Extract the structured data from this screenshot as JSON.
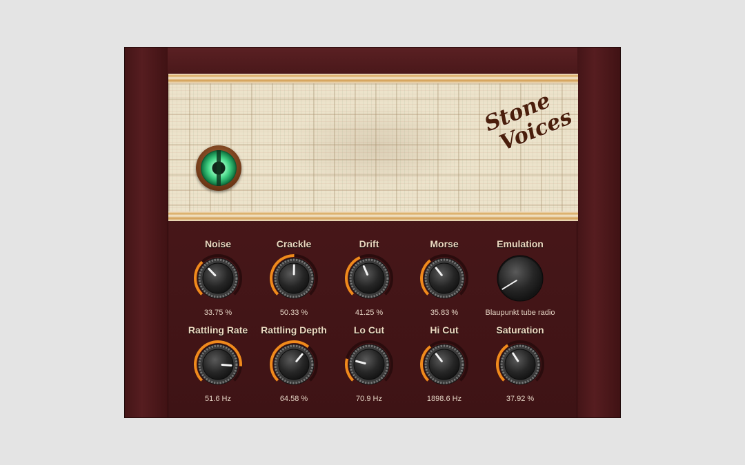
{
  "logo": {
    "line1": "Stone",
    "line2": "Voices"
  },
  "accent_color": "#f08a1c",
  "power_button": {
    "icon": "power-lamp-icon"
  },
  "knobs": [
    {
      "name": "noise",
      "label": "Noise",
      "value": "33.75 %",
      "fraction": 0.3375
    },
    {
      "name": "crackle",
      "label": "Crackle",
      "value": "50.33 %",
      "fraction": 0.5033
    },
    {
      "name": "drift",
      "label": "Drift",
      "value": "41.25 %",
      "fraction": 0.4125
    },
    {
      "name": "morse",
      "label": "Morse",
      "value": "35.83 %",
      "fraction": 0.3583
    },
    {
      "name": "emulation",
      "label": "Emulation",
      "value": "Blaupunkt tube radio",
      "fraction": 0.05
    },
    {
      "name": "rattling-rate",
      "label": "Rattling Rate",
      "value": "51.6 Hz",
      "fraction": 0.85
    },
    {
      "name": "rattling-depth",
      "label": "Rattling Depth",
      "value": "64.58 %",
      "fraction": 0.6458
    },
    {
      "name": "lo-cut",
      "label": "Lo Cut",
      "value": "70.9 Hz",
      "fraction": 0.22
    },
    {
      "name": "hi-cut",
      "label": "Hi Cut",
      "value": "1898.6 Hz",
      "fraction": 0.36
    },
    {
      "name": "saturation",
      "label": "Saturation",
      "value": "37.92 %",
      "fraction": 0.3792
    }
  ]
}
